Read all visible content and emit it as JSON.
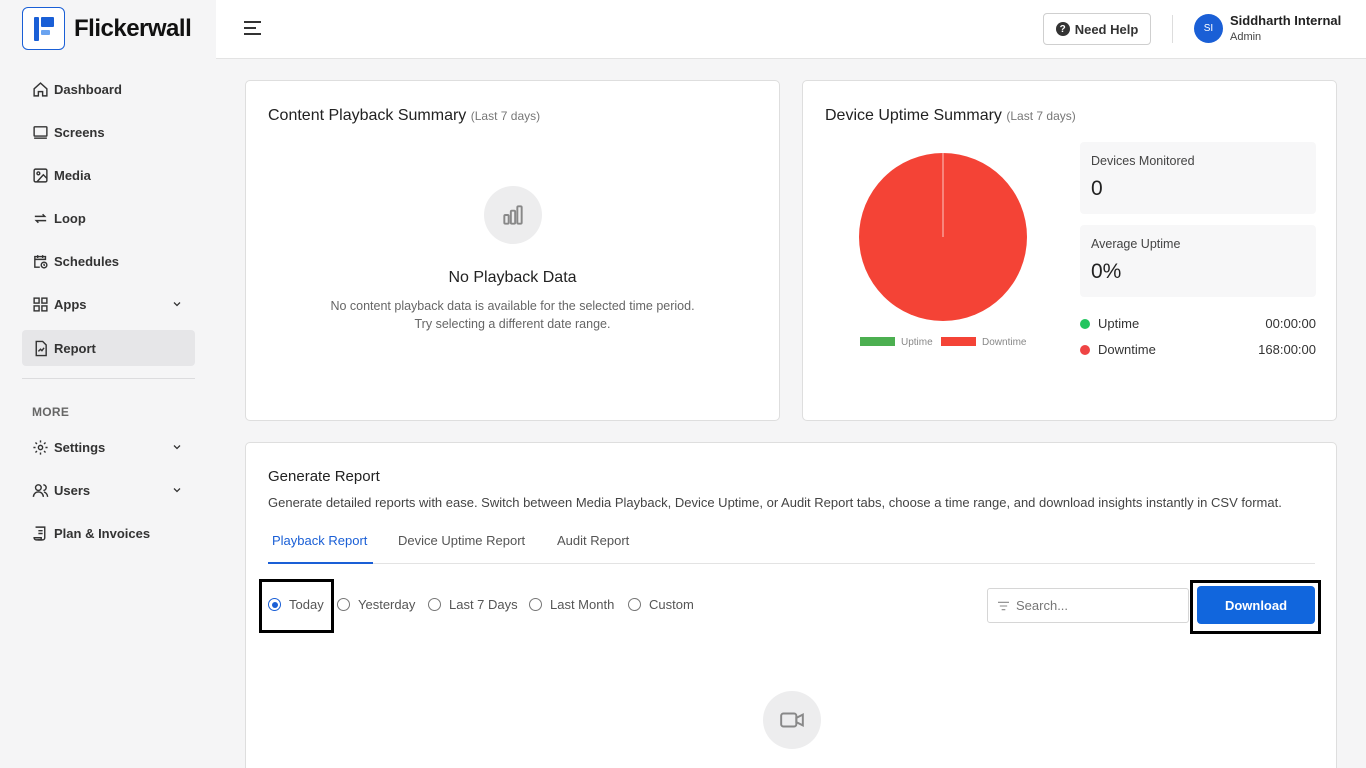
{
  "brand": {
    "name": "Flickerwall",
    "accent": "#1a5fd6"
  },
  "sidebar": {
    "items": [
      {
        "label": "Dashboard",
        "icon": "home-icon"
      },
      {
        "label": "Screens",
        "icon": "screen-icon"
      },
      {
        "label": "Media",
        "icon": "image-icon"
      },
      {
        "label": "Loop",
        "icon": "loop-icon"
      },
      {
        "label": "Schedules",
        "icon": "calendar-clock-icon"
      },
      {
        "label": "Apps",
        "icon": "grid-icon",
        "expandable": true
      },
      {
        "label": "Report",
        "icon": "report-icon",
        "active": true
      }
    ],
    "more_label": "MORE",
    "more_items": [
      {
        "label": "Settings",
        "icon": "gear-icon",
        "expandable": true
      },
      {
        "label": "Users",
        "icon": "users-icon",
        "expandable": true
      },
      {
        "label": "Plan & Invoices",
        "icon": "invoice-icon"
      }
    ]
  },
  "header": {
    "help_label": "Need Help",
    "user": {
      "initials": "SI",
      "name": "Siddharth Internal",
      "role": "Admin"
    }
  },
  "playback_summary": {
    "title": "Content Playback Summary",
    "subtitle": "(Last 7 days)",
    "empty_title": "No Playback Data",
    "empty_line1": "No content playback data is available for the selected time period.",
    "empty_line2": "Try selecting a different date range."
  },
  "uptime_summary": {
    "title": "Device Uptime Summary",
    "subtitle": "(Last 7 days)",
    "devices_monitored_label": "Devices Monitored",
    "devices_monitored_value": "0",
    "average_uptime_label": "Average Uptime",
    "average_uptime_value": "0%",
    "uptime_label": "Uptime",
    "uptime_value": "00:00:00",
    "downtime_label": "Downtime",
    "downtime_value": "168:00:00",
    "colors": {
      "uptime": "#4caf50",
      "downtime": "#f44336"
    }
  },
  "chart_data": {
    "type": "pie",
    "categories": [
      "Uptime",
      "Downtime"
    ],
    "values": [
      0,
      168
    ],
    "legend": "bottom",
    "colors": [
      "#4caf50",
      "#f44336"
    ]
  },
  "generate_report": {
    "title": "Generate Report",
    "description": "Generate detailed reports with ease. Switch between Media Playback, Device Uptime, or Audit Report tabs, choose a time range, and download insights instantly in CSV format.",
    "tabs": [
      {
        "label": "Playback Report",
        "active": true
      },
      {
        "label": "Device Uptime Report",
        "active": false
      },
      {
        "label": "Audit Report",
        "active": false
      }
    ],
    "ranges": [
      {
        "label": "Today",
        "checked": true
      },
      {
        "label": "Yesterday",
        "checked": false
      },
      {
        "label": "Last 7 Days",
        "checked": false
      },
      {
        "label": "Last Month",
        "checked": false
      },
      {
        "label": "Custom",
        "checked": false
      }
    ],
    "search_placeholder": "Search...",
    "download_label": "Download"
  }
}
